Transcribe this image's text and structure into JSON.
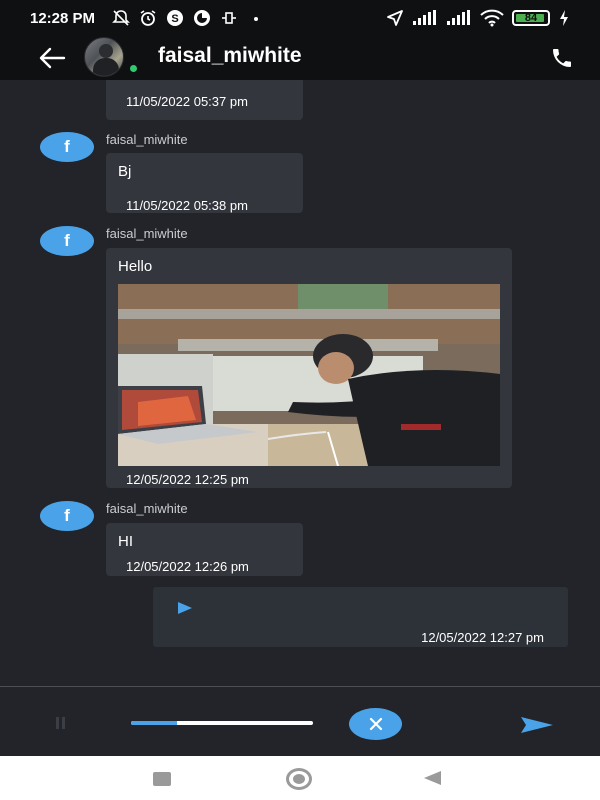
{
  "status_bar": {
    "time": "12:28 PM",
    "battery_level": "84",
    "icons_left": [
      "muted-notification-icon",
      "alarm-icon",
      "skype-icon",
      "app-icon",
      "usb-debug-icon",
      "dot-icon"
    ],
    "icons_right": [
      "location-arrow-icon",
      "signal-icon",
      "signal-icon",
      "wifi-icon",
      "battery-icon",
      "charging-icon"
    ]
  },
  "header": {
    "title": "faisal_miwhite",
    "online": true
  },
  "colors": {
    "header_bg": "#0f1012",
    "chat_bg": "#222429",
    "bubble_bg": "#33363c",
    "accent": "#4aa3e8",
    "online": "#2ecc71"
  },
  "messages": [
    {
      "sender": "",
      "avatar_letter": "",
      "text": "",
      "timestamp": "11/05/2022 05:37 pm"
    },
    {
      "sender": "faisal_miwhite",
      "avatar_letter": "f",
      "text": "Bj",
      "timestamp": "11/05/2022 05:38 pm"
    },
    {
      "sender": "faisal_miwhite",
      "avatar_letter": "f",
      "text": "Hello",
      "has_image": true,
      "timestamp": "12/05/2022 12:25 pm"
    },
    {
      "sender": "faisal_miwhite",
      "avatar_letter": "f",
      "text": "HI",
      "timestamp": "12/05/2022 12:26 pm"
    }
  ],
  "outgoing": {
    "type": "voice",
    "timestamp": "12/05/2022 12:27 pm"
  },
  "composer": {
    "recording_progress": 0.25
  }
}
